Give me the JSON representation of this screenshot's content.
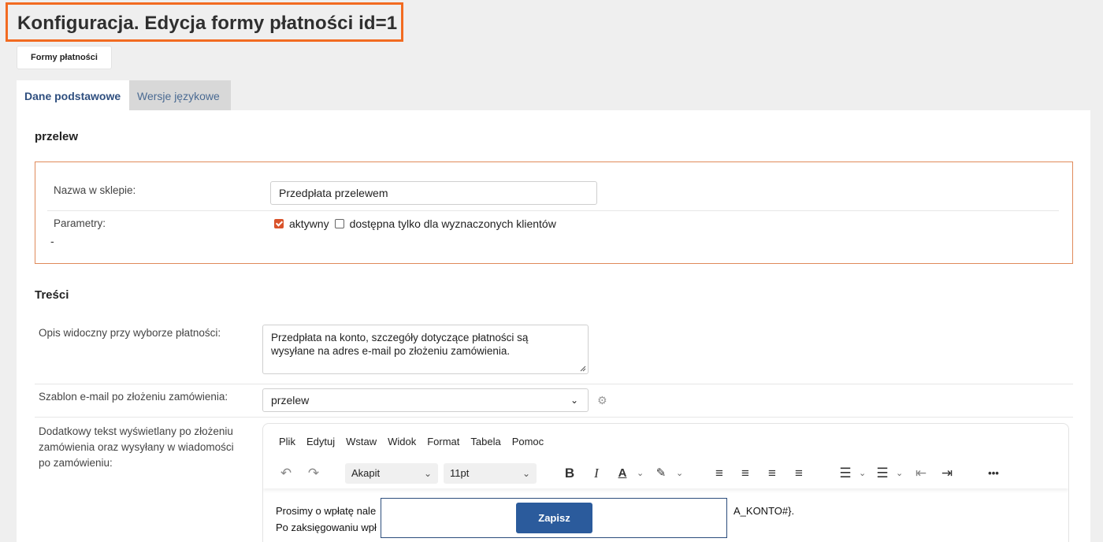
{
  "page": {
    "title": "Konfiguracja. Edycja formy płatności id=1"
  },
  "nav": {
    "back_button": "Formy płatności"
  },
  "tabs": [
    {
      "label": "Dane podstawowe",
      "active": true
    },
    {
      "label": "Wersje językowe",
      "active": false
    }
  ],
  "basic": {
    "section_title": "przelew",
    "name_label": "Nazwa w sklepie:",
    "name_value": "Przedpłata przelewem",
    "params_label": "Parametry:",
    "active_label": "aktywny",
    "active_checked": true,
    "restricted_label": "dostępna tylko dla wyznaczonych klientów",
    "restricted_checked": false,
    "dash": "-"
  },
  "content": {
    "section_title": "Treści",
    "desc_label": "Opis widoczny przy wyborze płatności:",
    "desc_line1": "Przedpłata na konto, szczegóły dotyczące płatności są",
    "desc_line2": "wysyłane na adres e-mail po złożeniu zamówienia.",
    "template_label": "Szablon e-mail po złożeniu zamówienia:",
    "template_value": "przelew",
    "extra_label_line1": "Dodatkowy tekst wyświetlany po złożeniu",
    "extra_label_line2": "zamówienia oraz wysyłany w wiadomości",
    "extra_label_line3": "po zamówieniu:"
  },
  "editor": {
    "menu": [
      "Plik",
      "Edytuj",
      "Wstaw",
      "Widok",
      "Format",
      "Tabela",
      "Pomoc"
    ],
    "block_format": "Akapit",
    "font_size": "11pt",
    "more": "•••",
    "text_line1_start": "Prosimy o wpłatę nale",
    "text_line1_end": "A_KONTO#}.",
    "text_line2_start": "Po zaksięgowaniu wpł"
  },
  "actions": {
    "save_label": "Zapisz"
  },
  "colors": {
    "accent": "#f26b21",
    "primary": "#2b5b9c",
    "checkbox": "#d9532b"
  }
}
